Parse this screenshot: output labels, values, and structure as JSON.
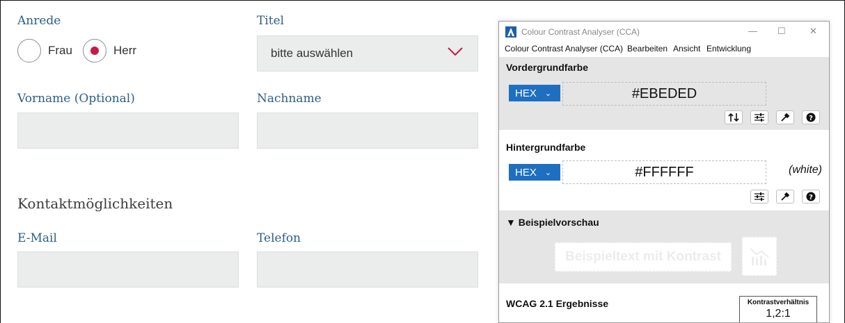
{
  "form": {
    "salutation_label": "Anrede",
    "radio_frau": "Frau",
    "radio_herr": "Herr",
    "selected_salutation": "Herr",
    "title_label": "Titel",
    "title_select_value": "bitte auswählen",
    "firstname_label": "Vorname (Optional)",
    "lastname_label": "Nachname",
    "contact_section": "Kontaktmöglichkeiten",
    "email_label": "E-Mail",
    "phone_label": "Telefon",
    "accent_color": "#c8184a",
    "field_bg": "#ebeded",
    "label_color": "#2b5f86"
  },
  "cca": {
    "window_title": "Colour Contrast Analyser (CCA)",
    "menu": [
      "Colour Contrast Analyser (CCA)",
      "Bearbeiten",
      "Ansicht",
      "Entwicklung"
    ],
    "foreground": {
      "title": "Vordergrundfarbe",
      "format": "HEX",
      "value": "#EBEDED"
    },
    "background": {
      "title": "Hintergrundfarbe",
      "color_name": "(white)",
      "format": "HEX",
      "value": "#FFFFFF"
    },
    "preview": {
      "title": "▼ Beispielvorschau",
      "sample_text": "Beispieltext mit Kontrast"
    },
    "results": {
      "title": "WCAG 2.1 Ergebnisse",
      "ratio_label": "Kontrastverhältnis",
      "ratio_value": "1,2:1"
    },
    "icons": [
      "swap-icon",
      "sliders-icon",
      "eyedropper-icon",
      "help-icon",
      "app-icon",
      "chart-image-icon"
    ],
    "accent": "#1f6fc0"
  }
}
